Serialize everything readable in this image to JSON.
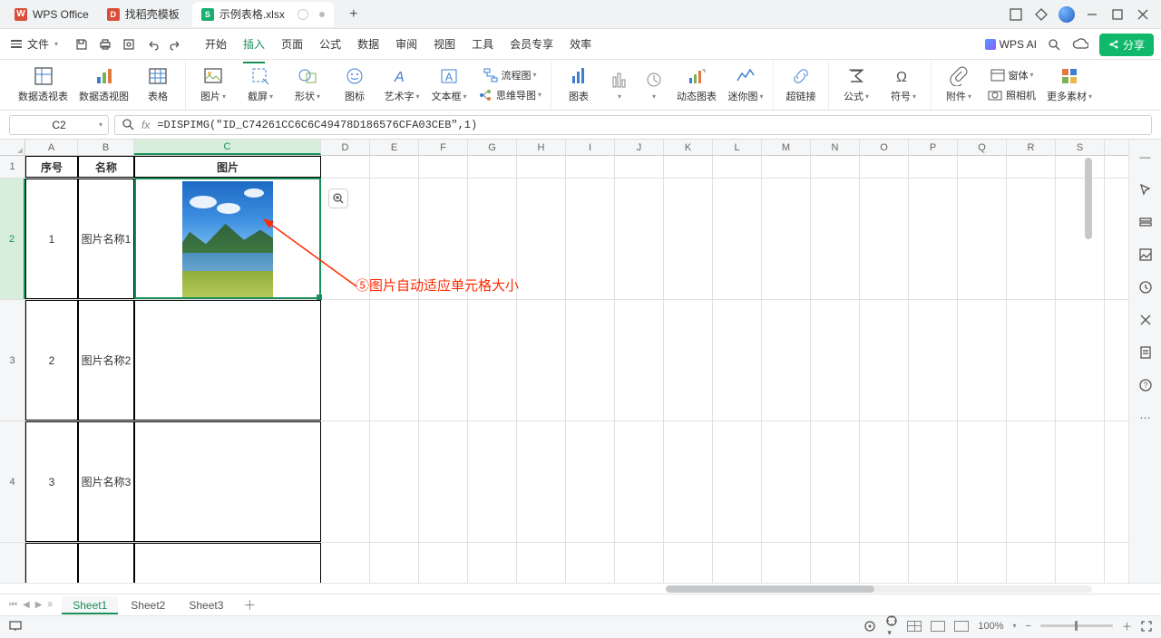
{
  "titlebar": {
    "wps_label": "WPS Office",
    "template_label": "找稻壳模板",
    "doc_name": "示例表格.xlsx",
    "plus": "+"
  },
  "menubar": {
    "file": "文件",
    "tabs": [
      "开始",
      "插入",
      "页面",
      "公式",
      "数据",
      "审阅",
      "视图",
      "工具",
      "会员专享",
      "效率"
    ],
    "active_index": 1,
    "ai_label": "WPS AI",
    "share": "分享"
  },
  "ribbon": {
    "pivot_table": "数据透视表",
    "pivot_chart": "数据透视图",
    "table": "表格",
    "picture": "图片",
    "screenshot": "截屏",
    "shape": "形状",
    "icon": "图标",
    "wordart": "艺术字",
    "textbox": "文本框",
    "flowchart": "流程图",
    "mindmap": "思维导图",
    "chart": "图表",
    "dynamic_chart": "动态图表",
    "sparkline": "迷你图",
    "hyperlink": "超链接",
    "formula": "公式",
    "symbol": "符号",
    "attachment": "附件",
    "camera": "照相机",
    "form": "窗体",
    "more": "更多素材"
  },
  "formula_bar": {
    "cell_ref": "C2",
    "fx": "fx",
    "formula": "=DISPIMG(\"ID_C74261CC6C6C49478D186576CFA03CEB\",1)"
  },
  "grid": {
    "columns": [
      "A",
      "B",
      "C",
      "D",
      "E",
      "F",
      "G",
      "H",
      "I",
      "J",
      "K",
      "L",
      "M",
      "N",
      "O",
      "P",
      "Q",
      "R",
      "S"
    ],
    "header_row": {
      "num": "1",
      "a": "序号",
      "b": "名称",
      "c": "图片"
    },
    "rows": [
      {
        "num": "2",
        "a": "1",
        "b": "图片名称1",
        "has_image": true
      },
      {
        "num": "3",
        "a": "2",
        "b": "图片名称2",
        "has_image": false
      },
      {
        "num": "4",
        "a": "3",
        "b": "图片名称3",
        "has_image": false
      }
    ],
    "annotation": "⑤图片自动适应单元格大小"
  },
  "sheets": {
    "tabs": [
      "Sheet1",
      "Sheet2",
      "Sheet3"
    ],
    "active_index": 0
  },
  "status": {
    "zoom": "100%"
  }
}
